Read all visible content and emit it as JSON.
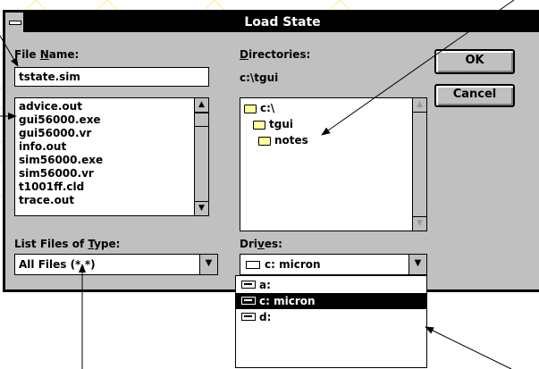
{
  "window": {
    "title": "Load State"
  },
  "file_name": {
    "label_pre": "File ",
    "label_key": "N",
    "label_post": "ame:",
    "value": "tstate.sim"
  },
  "files": [
    "advice.out",
    "gui56000.exe",
    "gui56000.vr",
    "info.out",
    "sim56000.exe",
    "sim56000.vr",
    "t1001ff.cld",
    "trace.out"
  ],
  "directories": {
    "label_key": "D",
    "label_post": "irectories:",
    "current_path": "c:\\tgui",
    "items": [
      {
        "name": "c:\\",
        "icon": "open-folder-icon"
      },
      {
        "name": "tgui",
        "icon": "open-folder-icon"
      },
      {
        "name": "notes",
        "icon": "folder-icon"
      }
    ]
  },
  "list_type": {
    "label_pre": "List Files of ",
    "label_key": "T",
    "label_post": "ype:",
    "value": "All Files (*.*)"
  },
  "drives": {
    "label_pre": "Dri",
    "label_key": "v",
    "label_post": "es:",
    "value": "c: micron",
    "options": [
      {
        "label": "a:",
        "icon": "floppy-drive-icon",
        "selected": false
      },
      {
        "label": "c: micron",
        "icon": "hard-drive-icon",
        "selected": true
      },
      {
        "label": "d:",
        "icon": "network-drive-icon",
        "selected": false
      }
    ]
  },
  "buttons": {
    "ok": "OK",
    "cancel": "Cancel"
  },
  "colors": {
    "title_bar": "#000000",
    "dialog_face": "#c0c0c0",
    "watermark": "#ffe000",
    "selection": "#000000"
  }
}
